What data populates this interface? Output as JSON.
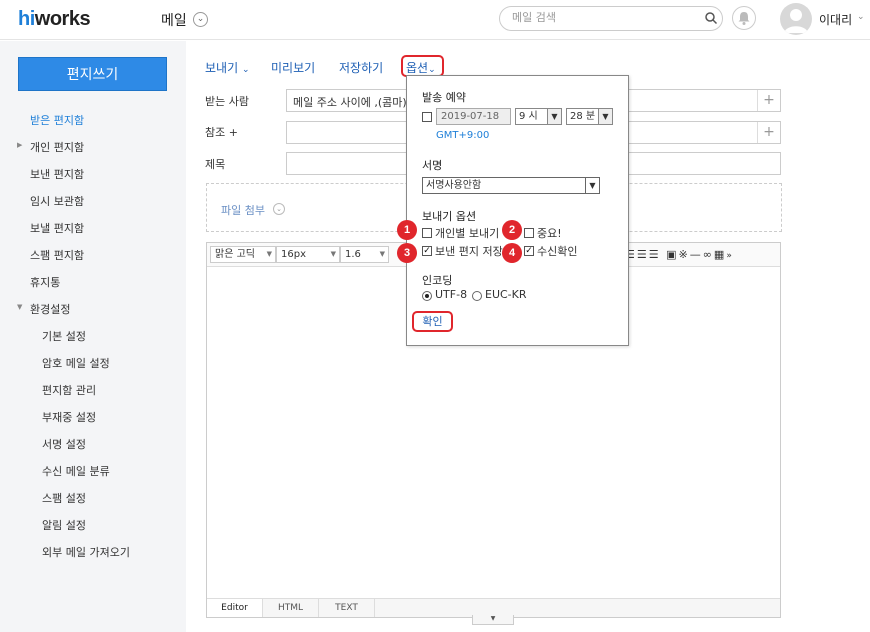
{
  "header": {
    "logo_hi": "hi",
    "logo_works": "works",
    "app_title": "메일",
    "search_placeholder": "메일 검색",
    "user_name": "이대리"
  },
  "sidebar": {
    "compose_label": "편지쓰기",
    "items": [
      {
        "label": "받은 편지함",
        "active": true
      },
      {
        "label": "개인 편지함",
        "expandable": true
      },
      {
        "label": "보낸 편지함"
      },
      {
        "label": "임시 보관함"
      },
      {
        "label": "보낼 편지함"
      },
      {
        "label": "스팸 편지함"
      },
      {
        "label": "휴지통"
      },
      {
        "label": "환경설정",
        "expanded": true
      }
    ],
    "settings": [
      "기본 설정",
      "암호 메일 설정",
      "편지함 관리",
      "부재중 설정",
      "서명 설정",
      "수신 메일 분류",
      "스팸 설정",
      "알림 설정",
      "외부 메일 가져오기"
    ]
  },
  "compose": {
    "send_label": "보내기",
    "preview_label": "미리보기",
    "save_label": "저장하기",
    "options_label": "옵션",
    "to_label": "받는 사람",
    "to_hint": "메일 주소 사이에 ,(콤마)",
    "cc_label": "참조 +",
    "subject_label": "제목",
    "attach_label": "파일 첨부",
    "plus": "+"
  },
  "editor": {
    "font": "맑은 고딕",
    "size": "16px",
    "line_height": "1.6",
    "tabs": [
      "Editor",
      "HTML",
      "TEXT"
    ]
  },
  "options_panel": {
    "schedule_heading": "발송 예약",
    "date": "2019-07-18",
    "hour": "9 시",
    "minute": "28 분",
    "timezone": "GMT+9:00",
    "signature_heading": "서명",
    "signature_value": "서명사용안함",
    "send_options_heading": "보내기 옵션",
    "individual_send": "개인별 보내기",
    "important": "중요!",
    "save_sent": "보낸 편지 저장",
    "read_receipt": "수신확인",
    "encoding_heading": "인코딩",
    "utf8": "UTF-8",
    "euckr": "EUC-KR",
    "confirm_label": "확인",
    "checked_save_sent": true,
    "checked_read_receipt": true,
    "selected_encoding": "UTF-8"
  },
  "callouts": [
    "1",
    "2",
    "3",
    "4"
  ],
  "colors": {
    "accent": "#2e8ae6",
    "link": "#1e5fb4",
    "highlight": "#e0262c",
    "sidebar_bg": "#f4f5f7"
  }
}
